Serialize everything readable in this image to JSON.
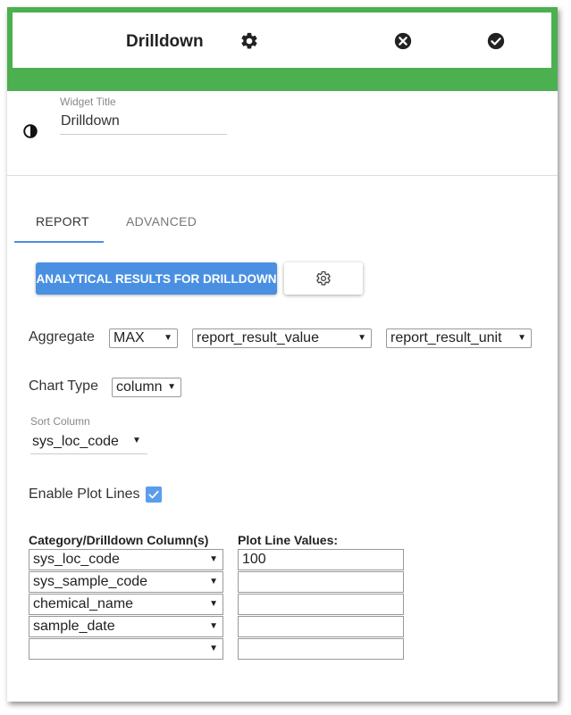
{
  "header": {
    "title": "Drilldown",
    "settings_icon": "gear-icon",
    "cancel_icon": "close-circle-icon",
    "confirm_icon": "check-circle-icon",
    "accent": "#4caf50"
  },
  "widget_title": {
    "label": "Widget Title",
    "value": "Drilldown",
    "icon": "contrast-icon"
  },
  "tabs": [
    {
      "label": "REPORT",
      "active": true
    },
    {
      "label": "ADVANCED",
      "active": false
    }
  ],
  "report_button": {
    "label": "ANALYTICAL RESULTS FOR DRILLDOWN",
    "color": "#4a90e2"
  },
  "report_settings_icon": "gear-icon",
  "aggregate": {
    "label": "Aggregate",
    "function": "MAX",
    "value_column": "report_result_value",
    "unit_column": "report_result_unit"
  },
  "chart_type": {
    "label": "Chart Type",
    "value": "column"
  },
  "sort_column": {
    "label": "Sort Column",
    "value": "sys_loc_code"
  },
  "plot_lines": {
    "label": "Enable Plot Lines",
    "checked": true
  },
  "drilldown": {
    "category_header": "Category/Drilldown Column(s)",
    "plotline_header": "Plot Line Values:",
    "rows": [
      {
        "category": "sys_loc_code",
        "plot_value": "100"
      },
      {
        "category": "sys_sample_code",
        "plot_value": ""
      },
      {
        "category": "chemical_name",
        "plot_value": ""
      },
      {
        "category": "sample_date",
        "plot_value": ""
      },
      {
        "category": "",
        "plot_value": ""
      }
    ]
  }
}
